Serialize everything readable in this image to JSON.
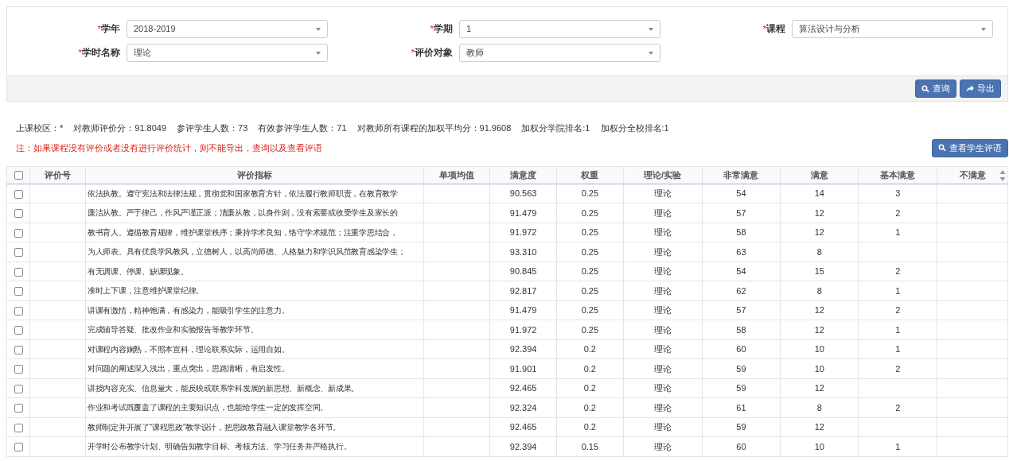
{
  "filters": [
    {
      "mark": "*",
      "label": "学年",
      "value": "2018-2019"
    },
    {
      "mark": "*",
      "label": "学期",
      "value": "1"
    },
    {
      "mark": "*",
      "label": "课程",
      "value": "算法设计与分析"
    },
    {
      "mark": "*",
      "label": "学时名称",
      "value": "理论"
    },
    {
      "mark": "*",
      "label": "评价对象",
      "value": "教师"
    }
  ],
  "toolbar_buttons": [
    {
      "kind": "search",
      "label": "查询"
    },
    {
      "kind": "share",
      "label": "导出"
    }
  ],
  "summary": [
    "上课校区：*",
    "对教师评价分：91.8049",
    "参评学生人数：73",
    "有效参评学生人数：71",
    "对教师所有课程的加权平均分：91.9608",
    "加权分学院排名:1",
    "加权分全校排名:1"
  ],
  "note": "注：如果课程没有评价或者没有进行评价统计，则不能导出，查询以及查看评语",
  "comments_button": {
    "kind": "search",
    "label": "查看学生评语"
  },
  "table": {
    "select_all": {
      "checked": false
    },
    "columns": [
      "评价号",
      "评价指标",
      "单项均值",
      "满意度",
      "权重",
      "理论/实验",
      "非常满意",
      "满意",
      "基本满意",
      "不满意"
    ],
    "rows": [
      {
        "selected": false,
        "cells": [
          "",
          "依法执教。遵守宪法和法律法规，贯彻党和国家教育方针，依法履行教师职责，在教育教学",
          "",
          "90.563",
          "0.25",
          "理论",
          "54",
          "14",
          "3",
          ""
        ]
      },
      {
        "selected": false,
        "cells": [
          "",
          "廉洁从教。严于律己，作风严谨正派；清廉从教，以身作则，没有索要或收受学生及家长的",
          "",
          "91.479",
          "0.25",
          "理论",
          "57",
          "12",
          "2",
          ""
        ]
      },
      {
        "selected": false,
        "cells": [
          "",
          "教书育人。遵循教育规律，维护课堂秩序；秉持学术良知，恪守学术规范；注重学思结合，",
          "",
          "91.972",
          "0.25",
          "理论",
          "58",
          "12",
          "1",
          ""
        ]
      },
      {
        "selected": false,
        "cells": [
          "",
          "为人师表。具有优良学风教风，立德树人，以高尚师德、人格魅力和学识风范教育感染学生；",
          "",
          "93.310",
          "0.25",
          "理论",
          "63",
          "8",
          "",
          ""
        ]
      },
      {
        "selected": false,
        "cells": [
          "",
          "有无调课、停课、缺课现象。",
          "",
          "90.845",
          "0.25",
          "理论",
          "54",
          "15",
          "2",
          ""
        ]
      },
      {
        "selected": false,
        "cells": [
          "",
          "准时上下课，注意维护课堂纪律。",
          "",
          "92.817",
          "0.25",
          "理论",
          "62",
          "8",
          "1",
          ""
        ]
      },
      {
        "selected": false,
        "cells": [
          "",
          "讲课有激情，精神饱满，有感染力，能吸引学生的注意力。",
          "",
          "91.479",
          "0.25",
          "理论",
          "57",
          "12",
          "2",
          ""
        ]
      },
      {
        "selected": false,
        "cells": [
          "",
          "完成辅导答疑、批改作业和实验报告等教学环节。",
          "",
          "91.972",
          "0.25",
          "理论",
          "58",
          "12",
          "1",
          ""
        ]
      },
      {
        "selected": false,
        "cells": [
          "",
          "对课程内容娴熟，不照本宣科，理论联系实际，运用自如。",
          "",
          "92.394",
          "0.2",
          "理论",
          "60",
          "10",
          "1",
          ""
        ]
      },
      {
        "selected": false,
        "cells": [
          "",
          "对问题的阐述深入浅出，重点突出，思路清晰，有启发性。",
          "",
          "91.901",
          "0.2",
          "理论",
          "59",
          "10",
          "2",
          ""
        ]
      },
      {
        "selected": false,
        "cells": [
          "",
          "讲授内容充实、信息量大，能反映或联系学科发展的新思想、新概念、新成果。",
          "",
          "92.465",
          "0.2",
          "理论",
          "59",
          "12",
          "",
          ""
        ]
      },
      {
        "selected": false,
        "cells": [
          "",
          "作业和考试既覆盖了课程的主要知识点，也能给学生一定的发挥空间。",
          "",
          "92.324",
          "0.2",
          "理论",
          "61",
          "8",
          "2",
          ""
        ]
      },
      {
        "selected": false,
        "cells": [
          "",
          "教师制定并开展了“课程思政”教学设计，把思政教育融入课堂教学各环节。",
          "",
          "92.465",
          "0.2",
          "理论",
          "59",
          "12",
          "",
          ""
        ]
      },
      {
        "selected": false,
        "cells": [
          "",
          "开学时公布教学计划、明确告知教学目标、考核方法、学习任务并严格执行。",
          "",
          "92.394",
          "0.15",
          "理论",
          "60",
          "10",
          "1",
          ""
        ]
      }
    ]
  }
}
